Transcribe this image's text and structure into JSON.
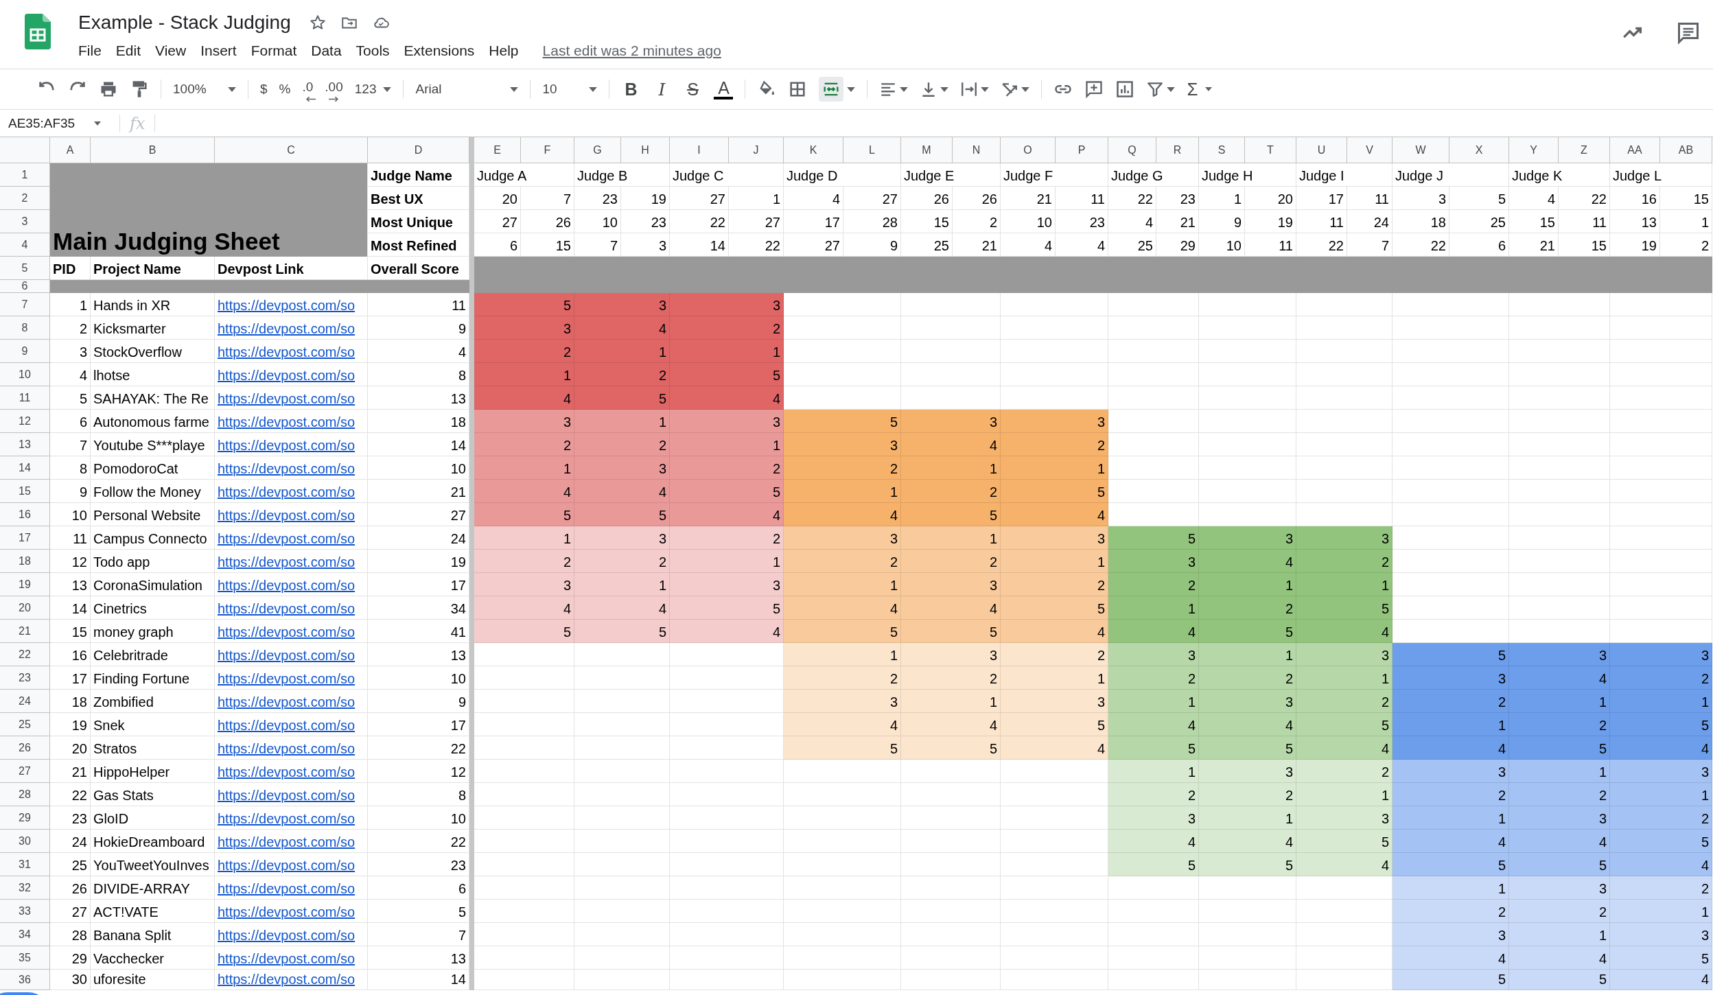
{
  "document": {
    "title": "Example - Stack Judging",
    "starred": false,
    "menus": [
      "File",
      "Edit",
      "View",
      "Insert",
      "Format",
      "Data",
      "Tools",
      "Extensions",
      "Help"
    ],
    "last_edit": "Last edit was 2 minutes ago"
  },
  "toolbar": {
    "zoom": "100%",
    "currency": "$",
    "percent": "%",
    "decrease_decimal": ".0",
    "increase_decimal": ".00",
    "number_format": "123",
    "font": "Arial",
    "font_size": "10",
    "bold": "B",
    "italic": "I",
    "strikethrough": "S",
    "text_color": "A",
    "merge_active": true,
    "sum": "Σ"
  },
  "formula_bar": {
    "name_box": "AE35:AF35",
    "fx": "fx"
  },
  "columns": [
    "A",
    "B",
    "C",
    "D",
    "E",
    "F",
    "G",
    "H",
    "I",
    "J",
    "K",
    "L",
    "M",
    "N",
    "O",
    "P",
    "Q",
    "R",
    "S",
    "T",
    "U",
    "V",
    "W",
    "X",
    "Y",
    "Z",
    "AA",
    "AB"
  ],
  "row_numbers": [
    "1",
    "2",
    "3",
    "4",
    "5",
    "6",
    "7",
    "8",
    "9",
    "10",
    "11",
    "12",
    "13",
    "14",
    "15",
    "16",
    "17",
    "18",
    "19",
    "20",
    "21",
    "22",
    "23",
    "24",
    "25",
    "26",
    "27",
    "28",
    "29",
    "30",
    "31",
    "32",
    "33",
    "34",
    "35",
    "36"
  ],
  "sheet": {
    "title": "Main Judging Sheet",
    "judge_label": "Judge Name",
    "headers": [
      "PID",
      "Project Name",
      "Devpost Link",
      "Overall Score"
    ],
    "criteria": [
      {
        "label": "Best UX",
        "values": [
          "20",
          "7",
          "23",
          "19",
          "27",
          "1",
          "4",
          "27",
          "26",
          "26",
          "21",
          "11",
          "22",
          "23",
          "1",
          "20",
          "17",
          "11",
          "3",
          "5",
          "4",
          "22",
          "16",
          "15"
        ]
      },
      {
        "label": "Most Unique",
        "values": [
          "27",
          "26",
          "10",
          "23",
          "22",
          "27",
          "17",
          "28",
          "15",
          "2",
          "10",
          "23",
          "4",
          "21",
          "9",
          "19",
          "11",
          "24",
          "18",
          "25",
          "15",
          "11",
          "13",
          "1"
        ]
      },
      {
        "label": "Most Refined",
        "values": [
          "6",
          "15",
          "7",
          "3",
          "14",
          "22",
          "27",
          "9",
          "25",
          "21",
          "4",
          "4",
          "25",
          "29",
          "10",
          "11",
          "22",
          "7",
          "22",
          "6",
          "21",
          "15",
          "19",
          "2"
        ]
      }
    ],
    "projects": [
      {
        "pid": "1",
        "name": "Hands in XR",
        "link": "https://devpost.com/so",
        "score": "11"
      },
      {
        "pid": "2",
        "name": "Kicksmarter",
        "link": "https://devpost.com/so",
        "score": "9"
      },
      {
        "pid": "3",
        "name": "StockOverflow",
        "link": "https://devpost.com/so",
        "score": "4"
      },
      {
        "pid": "4",
        "name": "lhotse",
        "link": "https://devpost.com/so",
        "score": "8"
      },
      {
        "pid": "5",
        "name": "SAHAYAK: The Re",
        "link": "https://devpost.com/so",
        "score": "13"
      },
      {
        "pid": "6",
        "name": "Autonomous farme",
        "link": "https://devpost.com/so",
        "score": "18"
      },
      {
        "pid": "7",
        "name": "Youtube S***playe",
        "link": "https://devpost.com/so",
        "score": "14"
      },
      {
        "pid": "8",
        "name": "PomodoroCat",
        "link": "https://devpost.com/so",
        "score": "10"
      },
      {
        "pid": "9",
        "name": "Follow the Money",
        "link": "https://devpost.com/so",
        "score": "21"
      },
      {
        "pid": "10",
        "name": "Personal Website",
        "link": "https://devpost.com/so",
        "score": "27"
      },
      {
        "pid": "11",
        "name": "Campus Connecto",
        "link": "https://devpost.com/so",
        "score": "24"
      },
      {
        "pid": "12",
        "name": "Todo app",
        "link": "https://devpost.com/so",
        "score": "19"
      },
      {
        "pid": "13",
        "name": "CoronaSimulation",
        "link": "https://devpost.com/so",
        "score": "17"
      },
      {
        "pid": "14",
        "name": "Cinetrics",
        "link": "https://devpost.com/so",
        "score": "34"
      },
      {
        "pid": "15",
        "name": "money graph",
        "link": "https://devpost.com/so",
        "score": "41"
      },
      {
        "pid": "16",
        "name": "Celebritrade",
        "link": "https://devpost.com/so",
        "score": "13"
      },
      {
        "pid": "17",
        "name": "Finding Fortune",
        "link": "https://devpost.com/so",
        "score": "10"
      },
      {
        "pid": "18",
        "name": "Zombified",
        "link": "https://devpost.com/so",
        "score": "9"
      },
      {
        "pid": "19",
        "name": "Snek",
        "link": "https://devpost.com/so",
        "score": "17"
      },
      {
        "pid": "20",
        "name": "Stratos",
        "link": "https://devpost.com/so",
        "score": "22"
      },
      {
        "pid": "21",
        "name": "HippoHelper",
        "link": "https://devpost.com/so",
        "score": "12"
      },
      {
        "pid": "22",
        "name": "Gas Stats",
        "link": "https://devpost.com/so",
        "score": "8"
      },
      {
        "pid": "23",
        "name": "GloID",
        "link": "https://devpost.com/so",
        "score": "10"
      },
      {
        "pid": "24",
        "name": "HokieDreamboard",
        "link": "https://devpost.com/so",
        "score": "22"
      },
      {
        "pid": "25",
        "name": "YouTweetYouInves",
        "link": "https://devpost.com/so",
        "score": "23"
      },
      {
        "pid": "26",
        "name": "DIVIDE-ARRAY",
        "link": "https://devpost.com/so",
        "score": "6"
      },
      {
        "pid": "27",
        "name": "ACT!VATE",
        "link": "https://devpost.com/so",
        "score": "5"
      },
      {
        "pid": "28",
        "name": "Banana Split",
        "link": "https://devpost.com/so",
        "score": "7"
      },
      {
        "pid": "29",
        "name": "Vacchecker",
        "link": "https://devpost.com/so",
        "score": "13"
      },
      {
        "pid": "30",
        "name": "uforesite",
        "link": "https://devpost.com/so",
        "score": "14"
      }
    ],
    "judge_panels": [
      {
        "judges": [
          "Judge A",
          "Judge B",
          "Judge C"
        ],
        "blocks": [
          {
            "color": "#e06666",
            "rows": [
              [
                "5",
                "3",
                "3"
              ],
              [
                "3",
                "4",
                "2"
              ],
              [
                "2",
                "1",
                "1"
              ],
              [
                "1",
                "2",
                "5"
              ],
              [
                "4",
                "5",
                "4"
              ]
            ]
          },
          {
            "color": "#ea9999",
            "rows": [
              [
                "3",
                "1",
                "3"
              ],
              [
                "2",
                "2",
                "1"
              ],
              [
                "1",
                "3",
                "2"
              ],
              [
                "4",
                "4",
                "5"
              ],
              [
                "5",
                "5",
                "4"
              ]
            ]
          },
          {
            "color": "#f4cccc",
            "rows": [
              [
                "1",
                "3",
                "2"
              ],
              [
                "2",
                "2",
                "1"
              ],
              [
                "3",
                "1",
                "3"
              ],
              [
                "4",
                "4",
                "5"
              ],
              [
                "5",
                "5",
                "4"
              ]
            ]
          }
        ]
      },
      {
        "judges": [
          "Judge D",
          "Judge E",
          "Judge F"
        ],
        "blocks": [
          {
            "color": "#f6b26b",
            "rows": [
              [
                "5",
                "3",
                "3"
              ],
              [
                "3",
                "4",
                "2"
              ],
              [
                "2",
                "1",
                "1"
              ],
              [
                "1",
                "2",
                "5"
              ],
              [
                "4",
                "5",
                "4"
              ]
            ]
          },
          {
            "color": "#f9cb9c",
            "rows": [
              [
                "3",
                "1",
                "3"
              ],
              [
                "2",
                "2",
                "1"
              ],
              [
                "1",
                "3",
                "2"
              ],
              [
                "4",
                "4",
                "5"
              ],
              [
                "5",
                "5",
                "4"
              ]
            ]
          },
          {
            "color": "#fce5cd",
            "rows": [
              [
                "1",
                "3",
                "2"
              ],
              [
                "2",
                "2",
                "1"
              ],
              [
                "3",
                "1",
                "3"
              ],
              [
                "4",
                "4",
                "5"
              ],
              [
                "5",
                "5",
                "4"
              ]
            ]
          }
        ]
      },
      {
        "judges": [
          "Judge G",
          "Judge H",
          "Judge I"
        ],
        "blocks": [
          {
            "color": "#93c47d",
            "rows": [
              [
                "5",
                "3",
                "3"
              ],
              [
                "3",
                "4",
                "2"
              ],
              [
                "2",
                "1",
                "1"
              ],
              [
                "1",
                "2",
                "5"
              ],
              [
                "4",
                "5",
                "4"
              ]
            ]
          },
          {
            "color": "#b6d7a8",
            "rows": [
              [
                "3",
                "1",
                "3"
              ],
              [
                "2",
                "2",
                "1"
              ],
              [
                "1",
                "3",
                "2"
              ],
              [
                "4",
                "4",
                "5"
              ],
              [
                "5",
                "5",
                "4"
              ]
            ]
          },
          {
            "color": "#d9ead3",
            "rows": [
              [
                "1",
                "3",
                "2"
              ],
              [
                "2",
                "2",
                "1"
              ],
              [
                "3",
                "1",
                "3"
              ],
              [
                "4",
                "4",
                "5"
              ],
              [
                "5",
                "5",
                "4"
              ]
            ]
          }
        ]
      },
      {
        "judges": [
          "Judge J",
          "Judge K",
          "Judge L"
        ],
        "blocks": [
          {
            "color": "#6d9eeb",
            "rows": [
              [
                "5",
                "3",
                "3"
              ],
              [
                "3",
                "4",
                "2"
              ],
              [
                "2",
                "1",
                "1"
              ],
              [
                "1",
                "2",
                "5"
              ],
              [
                "4",
                "5",
                "4"
              ]
            ]
          },
          {
            "color": "#a4c2f4",
            "rows": [
              [
                "3",
                "1",
                "3"
              ],
              [
                "2",
                "2",
                "1"
              ],
              [
                "1",
                "3",
                "2"
              ],
              [
                "4",
                "4",
                "5"
              ],
              [
                "5",
                "5",
                "4"
              ]
            ]
          },
          {
            "color": "#c9daf8",
            "rows": [
              [
                "1",
                "3",
                "2"
              ],
              [
                "2",
                "2",
                "1"
              ],
              [
                "3",
                "1",
                "3"
              ],
              [
                "4",
                "4",
                "5"
              ],
              [
                "5",
                "5",
                "4"
              ]
            ]
          }
        ]
      }
    ]
  }
}
